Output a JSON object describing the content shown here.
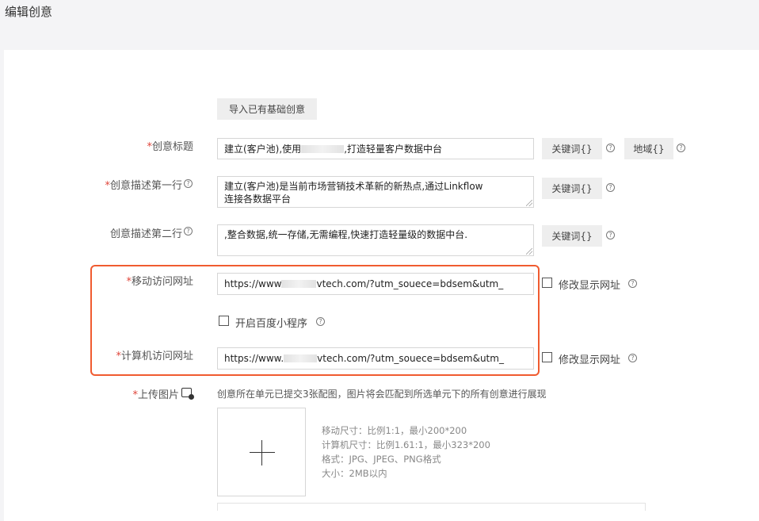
{
  "page": {
    "title": "编辑创意"
  },
  "toolbar": {
    "import_label": "导入已有基础创意"
  },
  "form": {
    "title": {
      "required_mark": "*",
      "label": "创意标题",
      "value_prefix": "建立(客户池),使用",
      "value_suffix": ",打造轻量客户数据中台",
      "keyword_button": "关键词{}",
      "region_button": "地域{}"
    },
    "desc1": {
      "required_mark": "*",
      "label": "创意描述第一行",
      "line1": "建立(客户池)是当前市场营销技术革新的新热点,通过Linkflow",
      "line2": "连接各数据平台",
      "keyword_button": "关键词{}"
    },
    "desc2": {
      "label": "创意描述第二行",
      "value": ",整合数据,统一存储,无需编程,快速打造轻量级的数据中台.",
      "keyword_button": "关键词{}"
    },
    "mobile_url": {
      "required_mark": "*",
      "label": "移动访问网址",
      "value_prefix": "https://www",
      "value_suffix": "vtech.com/?utm_souece=bdsem&utm_",
      "modify_label": "修改显示网址"
    },
    "baidu_mini": {
      "label": "开启百度小程序"
    },
    "pc_url": {
      "required_mark": "*",
      "label": "计算机访问网址",
      "value_prefix": "https://www.",
      "value_suffix": "vtech.com/?utm_souece=bdsem&utm_",
      "modify_label": "修改显示网址"
    },
    "upload": {
      "required_mark": "*",
      "label": "上传图片",
      "hint": "创意所在单元已提交3张配图，图片将会匹配到所选单元下的所有创意进行展现",
      "plus": "+",
      "specs": [
        "移动尺寸：比例1:1，最小200*200",
        "计算机尺寸：比例1.61:1，最小323*200",
        "格式：JPG、JPEG、PNG格式",
        "大小：2MB以内"
      ]
    }
  },
  "icons": {
    "help": "?"
  },
  "colors": {
    "required": "#e0453a",
    "highlight": "#f05b30",
    "panel": "#ffffff",
    "background": "#f4f4f6"
  }
}
